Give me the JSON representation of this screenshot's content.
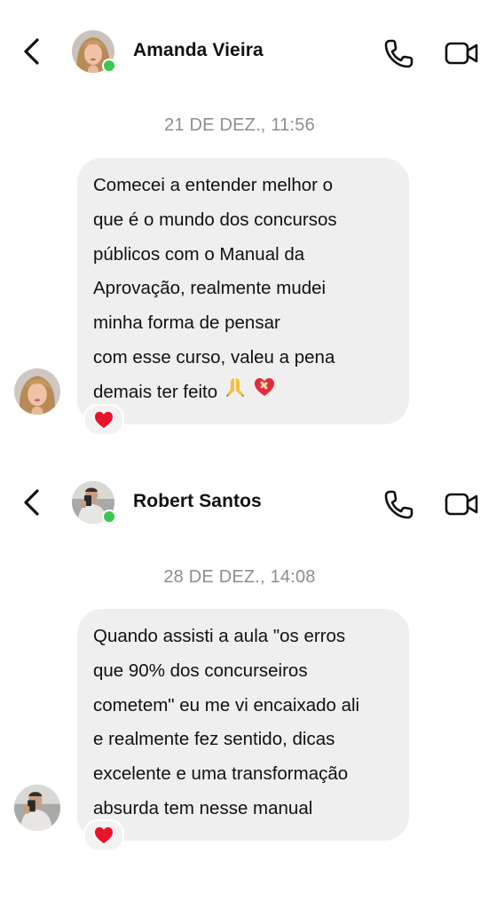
{
  "conversations": [
    {
      "contact": {
        "name": "Amanda Vieira",
        "online": true
      },
      "timestamp": "21 DE DEZ., 11:56",
      "message": {
        "text": "Comecei a entender melhor o\nque é o mundo dos concursos\npúblicos com o Manual da\nAprovação, realmente mudei\nminha forma de pensar\ncom esse curso, valeu a pena\ndemais ter feito",
        "emojis": [
          "folded-hands-icon",
          "mending-heart-icon"
        ],
        "reaction": "red-heart-icon"
      }
    },
    {
      "contact": {
        "name": "Robert Santos",
        "online": true
      },
      "timestamp": "28 DE DEZ., 14:08",
      "message": {
        "text": "Quando assisti a aula \"os erros\nque 90% dos concurseiros\ncometem\" eu me vi encaixado ali\ne realmente fez sentido, dicas\nexcelente e uma transformação\nabsurda tem nesse manual",
        "emojis": [],
        "reaction": "red-heart-icon"
      }
    }
  ],
  "colors": {
    "bubble": "#efefef",
    "timestamp": "#8e8e8e",
    "online": "#39c84c",
    "reaction_heart": "#e8142a"
  }
}
